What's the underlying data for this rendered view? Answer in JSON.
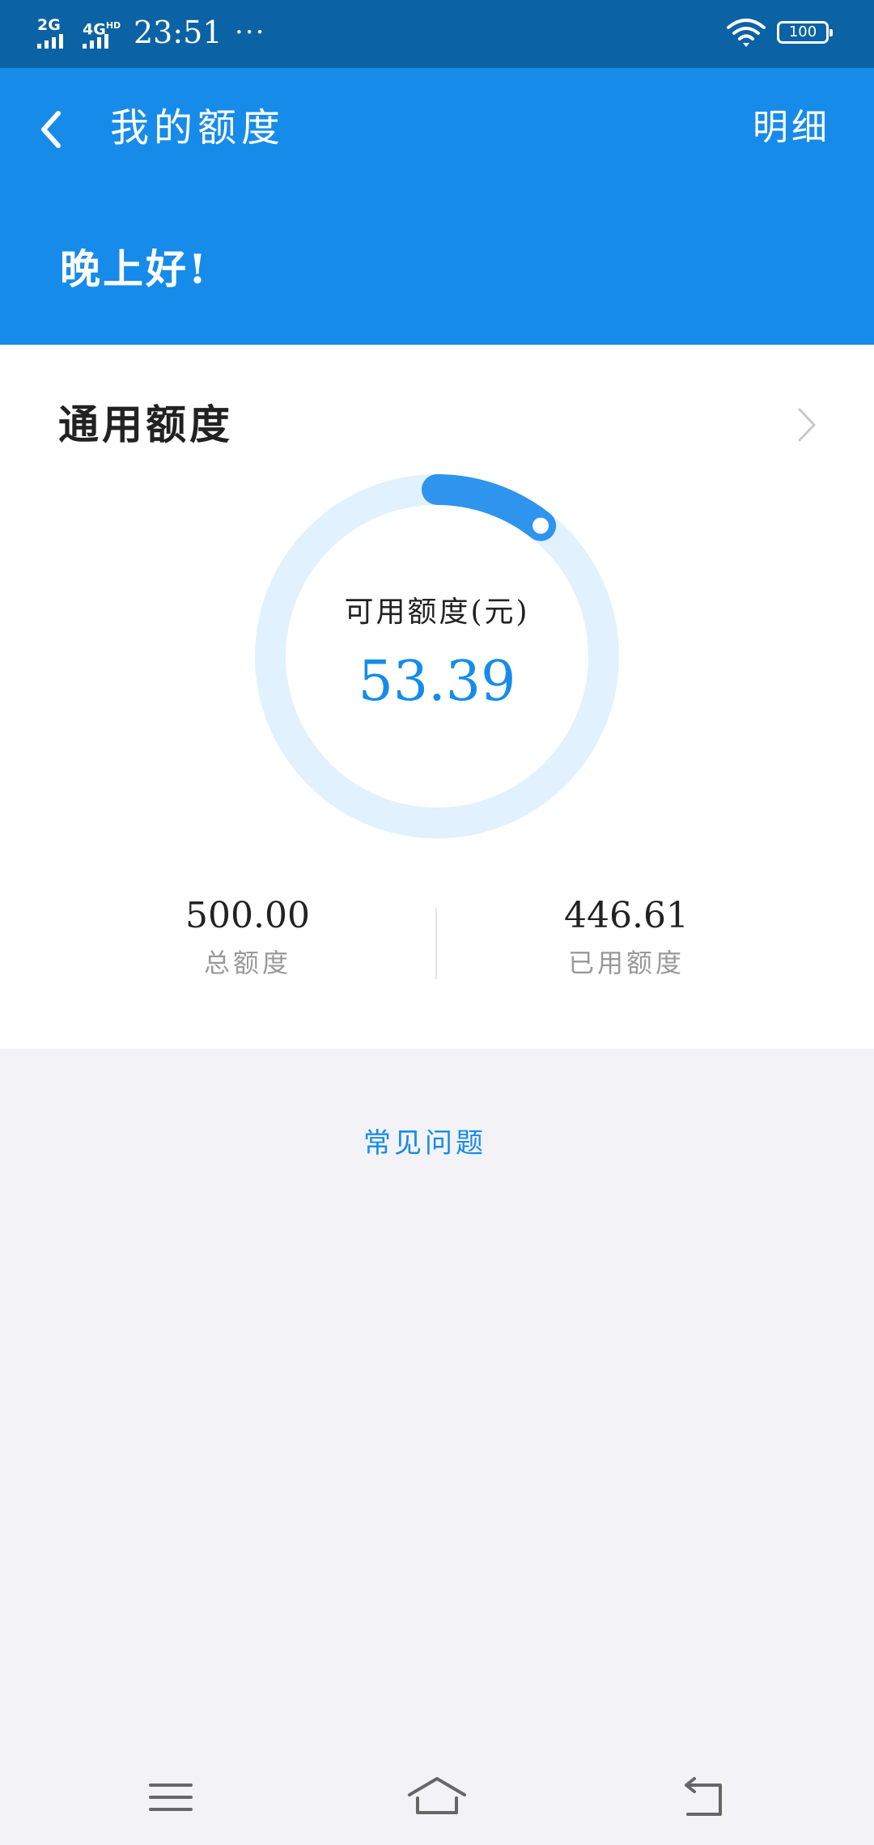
{
  "status_bar": {
    "sim1": "2G",
    "sim2": "4G",
    "sim2_badge": "HD",
    "time": "23:51",
    "more": "···",
    "battery": "100"
  },
  "header": {
    "title": "我的额度",
    "detail_link": "明细",
    "greeting": "晚上好!"
  },
  "credit": {
    "section_title": "通用额度",
    "available_label": "可用额度(元)",
    "available_value": "53.39",
    "total_value": "500.00",
    "total_label": "总额度",
    "used_value": "446.61",
    "used_label": "已用额度",
    "available_fraction": 0.1068
  },
  "faq_link": "常见问题",
  "colors": {
    "status_bar": "#0b62a4",
    "header": "#168bea",
    "accent": "#168bea",
    "ring_track": "#e1f1fd",
    "ring_progress": "#2e94ee",
    "page_bg": "#f3f3f7"
  },
  "icons": {
    "back": "chevron-left-icon",
    "section_arrow": "chevron-right-icon",
    "wifi": "wifi-icon",
    "battery": "battery-icon",
    "nav_menu": "menu-icon",
    "nav_home": "home-icon",
    "nav_back": "back-icon"
  }
}
